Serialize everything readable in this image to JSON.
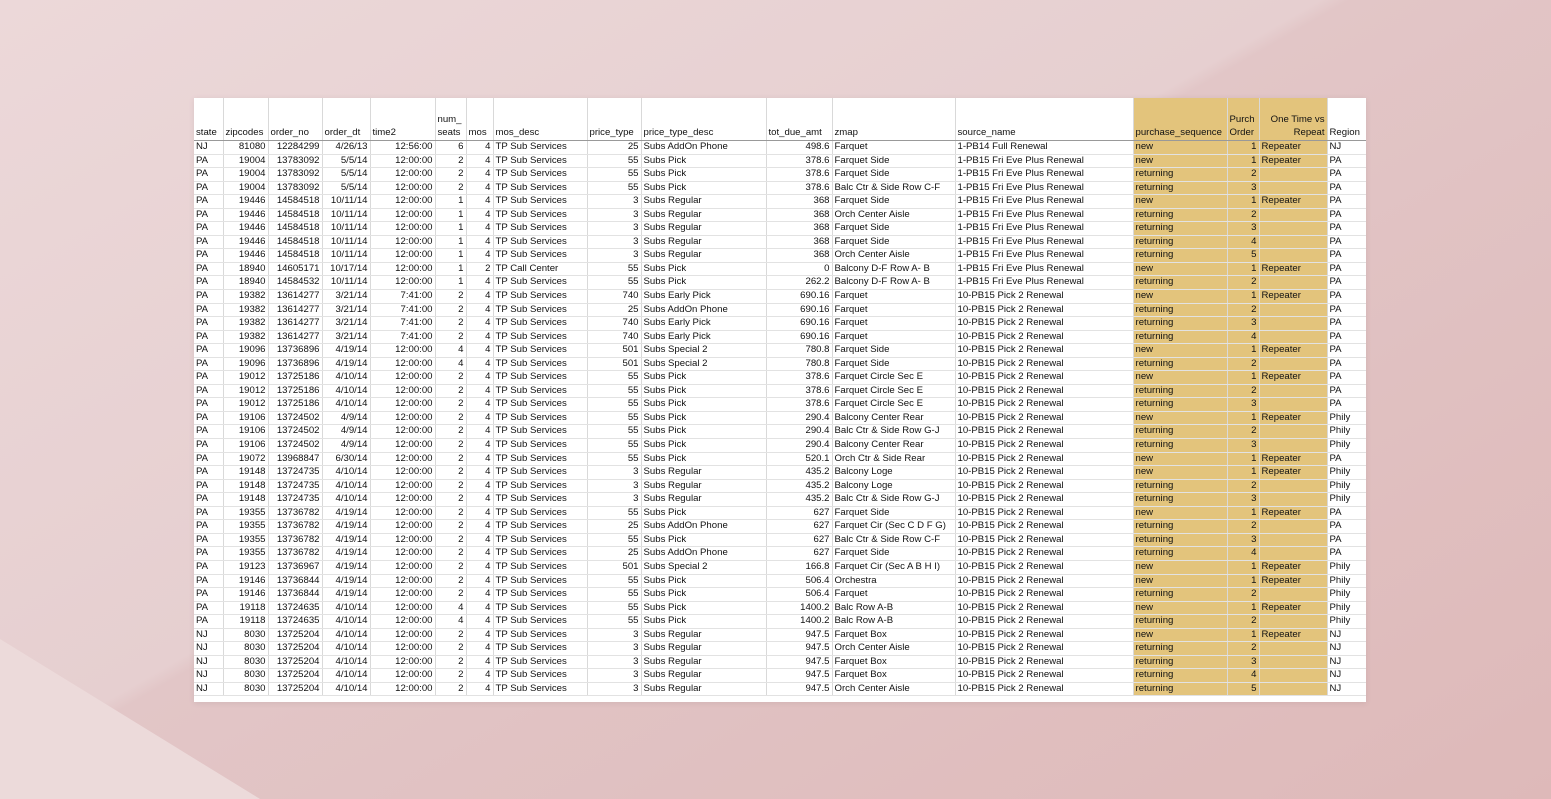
{
  "columns": [
    "state",
    "zipcodes",
    "order_no",
    "order_dt",
    "time2",
    "num_\nseats",
    "mos",
    "mos_desc",
    "price_type",
    "price_type_desc",
    "tot_due_amt",
    "zmap",
    "source_name",
    "purchase_sequence",
    "Purch\nOrder",
    "One Time vs\nRepeat",
    "Region"
  ],
  "rows": [
    [
      "NJ",
      "81080",
      "12284299",
      "4/26/13",
      "12:56:00",
      "6",
      "4",
      "TP Sub Services",
      "25",
      "Subs AddOn  Phone",
      "498.6",
      "Farquet",
      "1-PB14 Full Renewal",
      "new",
      "1",
      "Repeater",
      "NJ"
    ],
    [
      "PA",
      "19004",
      "13783092",
      "5/5/14",
      "12:00:00",
      "2",
      "4",
      "TP Sub Services",
      "55",
      "Subs Pick",
      "378.6",
      "Farquet Side",
      "1-PB15 Fri Eve Plus Renewal",
      "new",
      "1",
      "Repeater",
      "PA"
    ],
    [
      "PA",
      "19004",
      "13783092",
      "5/5/14",
      "12:00:00",
      "2",
      "4",
      "TP Sub Services",
      "55",
      "Subs Pick",
      "378.6",
      "Farquet Side",
      "1-PB15 Fri Eve Plus Renewal",
      "returning",
      "2",
      "",
      "PA"
    ],
    [
      "PA",
      "19004",
      "13783092",
      "5/5/14",
      "12:00:00",
      "2",
      "4",
      "TP Sub Services",
      "55",
      "Subs Pick",
      "378.6",
      "Balc Ctr & Side Row C-F",
      "1-PB15 Fri Eve Plus Renewal",
      "returning",
      "3",
      "",
      "PA"
    ],
    [
      "PA",
      "19446",
      "14584518",
      "10/11/14",
      "12:00:00",
      "1",
      "4",
      "TP Sub Services",
      "3",
      "Subs Regular",
      "368",
      "Farquet Side",
      "1-PB15 Fri Eve Plus Renewal",
      "new",
      "1",
      "Repeater",
      "PA"
    ],
    [
      "PA",
      "19446",
      "14584518",
      "10/11/14",
      "12:00:00",
      "1",
      "4",
      "TP Sub Services",
      "3",
      "Subs Regular",
      "368",
      "Orch Center Aisle",
      "1-PB15 Fri Eve Plus Renewal",
      "returning",
      "2",
      "",
      "PA"
    ],
    [
      "PA",
      "19446",
      "14584518",
      "10/11/14",
      "12:00:00",
      "1",
      "4",
      "TP Sub Services",
      "3",
      "Subs Regular",
      "368",
      "Farquet Side",
      "1-PB15 Fri Eve Plus Renewal",
      "returning",
      "3",
      "",
      "PA"
    ],
    [
      "PA",
      "19446",
      "14584518",
      "10/11/14",
      "12:00:00",
      "1",
      "4",
      "TP Sub Services",
      "3",
      "Subs Regular",
      "368",
      "Farquet Side",
      "1-PB15 Fri Eve Plus Renewal",
      "returning",
      "4",
      "",
      "PA"
    ],
    [
      "PA",
      "19446",
      "14584518",
      "10/11/14",
      "12:00:00",
      "1",
      "4",
      "TP Sub Services",
      "3",
      "Subs Regular",
      "368",
      "Orch Center Aisle",
      "1-PB15 Fri Eve Plus Renewal",
      "returning",
      "5",
      "",
      "PA"
    ],
    [
      "PA",
      "18940",
      "14605171",
      "10/17/14",
      "12:00:00",
      "1",
      "2",
      "TP Call Center",
      "55",
      "Subs Pick",
      "0",
      "Balcony D-F Row A- B",
      "1-PB15 Fri Eve Plus Renewal",
      "new",
      "1",
      "Repeater",
      "PA"
    ],
    [
      "PA",
      "18940",
      "14584532",
      "10/11/14",
      "12:00:00",
      "1",
      "4",
      "TP Sub Services",
      "55",
      "Subs Pick",
      "262.2",
      "Balcony D-F Row A- B",
      "1-PB15 Fri Eve Plus Renewal",
      "returning",
      "2",
      "",
      "PA"
    ],
    [
      "PA",
      "19382",
      "13614277",
      "3/21/14",
      "7:41:00",
      "2",
      "4",
      "TP Sub Services",
      "740",
      "Subs Early Pick",
      "690.16",
      "Farquet",
      "10-PB15 Pick 2 Renewal",
      "new",
      "1",
      "Repeater",
      "PA"
    ],
    [
      "PA",
      "19382",
      "13614277",
      "3/21/14",
      "7:41:00",
      "2",
      "4",
      "TP Sub Services",
      "25",
      "Subs AddOn  Phone",
      "690.16",
      "Farquet",
      "10-PB15 Pick 2 Renewal",
      "returning",
      "2",
      "",
      "PA"
    ],
    [
      "PA",
      "19382",
      "13614277",
      "3/21/14",
      "7:41:00",
      "2",
      "4",
      "TP Sub Services",
      "740",
      "Subs Early Pick",
      "690.16",
      "Farquet",
      "10-PB15 Pick 2 Renewal",
      "returning",
      "3",
      "",
      "PA"
    ],
    [
      "PA",
      "19382",
      "13614277",
      "3/21/14",
      "7:41:00",
      "2",
      "4",
      "TP Sub Services",
      "740",
      "Subs Early Pick",
      "690.16",
      "Farquet",
      "10-PB15 Pick 2 Renewal",
      "returning",
      "4",
      "",
      "PA"
    ],
    [
      "PA",
      "19096",
      "13736896",
      "4/19/14",
      "12:00:00",
      "4",
      "4",
      "TP Sub Services",
      "501",
      "Subs Special 2",
      "780.8",
      "Farquet Side",
      "10-PB15 Pick 2 Renewal",
      "new",
      "1",
      "Repeater",
      "PA"
    ],
    [
      "PA",
      "19096",
      "13736896",
      "4/19/14",
      "12:00:00",
      "4",
      "4",
      "TP Sub Services",
      "501",
      "Subs Special 2",
      "780.8",
      "Farquet Side",
      "10-PB15 Pick 2 Renewal",
      "returning",
      "2",
      "",
      "PA"
    ],
    [
      "PA",
      "19012",
      "13725186",
      "4/10/14",
      "12:00:00",
      "2",
      "4",
      "TP Sub Services",
      "55",
      "Subs Pick",
      "378.6",
      "Farquet Circle Sec E",
      "10-PB15 Pick 2 Renewal",
      "new",
      "1",
      "Repeater",
      "PA"
    ],
    [
      "PA",
      "19012",
      "13725186",
      "4/10/14",
      "12:00:00",
      "2",
      "4",
      "TP Sub Services",
      "55",
      "Subs Pick",
      "378.6",
      "Farquet Circle Sec E",
      "10-PB15 Pick 2 Renewal",
      "returning",
      "2",
      "",
      "PA"
    ],
    [
      "PA",
      "19012",
      "13725186",
      "4/10/14",
      "12:00:00",
      "2",
      "4",
      "TP Sub Services",
      "55",
      "Subs Pick",
      "378.6",
      "Farquet Circle Sec E",
      "10-PB15 Pick 2 Renewal",
      "returning",
      "3",
      "",
      "PA"
    ],
    [
      "PA",
      "19106",
      "13724502",
      "4/9/14",
      "12:00:00",
      "2",
      "4",
      "TP Sub Services",
      "55",
      "Subs Pick",
      "290.4",
      "Balcony Center Rear",
      "10-PB15 Pick 2 Renewal",
      "new",
      "1",
      "Repeater",
      "Phily"
    ],
    [
      "PA",
      "19106",
      "13724502",
      "4/9/14",
      "12:00:00",
      "2",
      "4",
      "TP Sub Services",
      "55",
      "Subs Pick",
      "290.4",
      "Balc Ctr & Side Row G-J",
      "10-PB15 Pick 2 Renewal",
      "returning",
      "2",
      "",
      "Phily"
    ],
    [
      "PA",
      "19106",
      "13724502",
      "4/9/14",
      "12:00:00",
      "2",
      "4",
      "TP Sub Services",
      "55",
      "Subs Pick",
      "290.4",
      "Balcony Center Rear",
      "10-PB15 Pick 2 Renewal",
      "returning",
      "3",
      "",
      "Phily"
    ],
    [
      "PA",
      "19072",
      "13968847",
      "6/30/14",
      "12:00:00",
      "2",
      "4",
      "TP Sub Services",
      "55",
      "Subs Pick",
      "520.1",
      "Orch Ctr & Side Rear",
      "10-PB15 Pick 2 Renewal",
      "new",
      "1",
      "Repeater",
      "PA"
    ],
    [
      "PA",
      "19148",
      "13724735",
      "4/10/14",
      "12:00:00",
      "2",
      "4",
      "TP Sub Services",
      "3",
      "Subs Regular",
      "435.2",
      "Balcony Loge",
      "10-PB15 Pick 2 Renewal",
      "new",
      "1",
      "Repeater",
      "Phily"
    ],
    [
      "PA",
      "19148",
      "13724735",
      "4/10/14",
      "12:00:00",
      "2",
      "4",
      "TP Sub Services",
      "3",
      "Subs Regular",
      "435.2",
      "Balcony Loge",
      "10-PB15 Pick 2 Renewal",
      "returning",
      "2",
      "",
      "Phily"
    ],
    [
      "PA",
      "19148",
      "13724735",
      "4/10/14",
      "12:00:00",
      "2",
      "4",
      "TP Sub Services",
      "3",
      "Subs Regular",
      "435.2",
      "Balc Ctr & Side Row G-J",
      "10-PB15 Pick 2 Renewal",
      "returning",
      "3",
      "",
      "Phily"
    ],
    [
      "PA",
      "19355",
      "13736782",
      "4/19/14",
      "12:00:00",
      "2",
      "4",
      "TP Sub Services",
      "55",
      "Subs Pick",
      "627",
      "Farquet Side",
      "10-PB15 Pick 2 Renewal",
      "new",
      "1",
      "Repeater",
      "PA"
    ],
    [
      "PA",
      "19355",
      "13736782",
      "4/19/14",
      "12:00:00",
      "2",
      "4",
      "TP Sub Services",
      "25",
      "Subs AddOn  Phone",
      "627",
      "Farquet Cir (Sec C  D  F  G)",
      "10-PB15 Pick 2 Renewal",
      "returning",
      "2",
      "",
      "PA"
    ],
    [
      "PA",
      "19355",
      "13736782",
      "4/19/14",
      "12:00:00",
      "2",
      "4",
      "TP Sub Services",
      "55",
      "Subs Pick",
      "627",
      "Balc Ctr & Side Row C-F",
      "10-PB15 Pick 2 Renewal",
      "returning",
      "3",
      "",
      "PA"
    ],
    [
      "PA",
      "19355",
      "13736782",
      "4/19/14",
      "12:00:00",
      "2",
      "4",
      "TP Sub Services",
      "25",
      "Subs AddOn  Phone",
      "627",
      "Farquet Side",
      "10-PB15 Pick 2 Renewal",
      "returning",
      "4",
      "",
      "PA"
    ],
    [
      "PA",
      "19123",
      "13736967",
      "4/19/14",
      "12:00:00",
      "2",
      "4",
      "TP Sub Services",
      "501",
      "Subs Special 2",
      "166.8",
      "Farquet Cir (Sec A  B  H  I)",
      "10-PB15 Pick 2 Renewal",
      "new",
      "1",
      "Repeater",
      "Phily"
    ],
    [
      "PA",
      "19146",
      "13736844",
      "4/19/14",
      "12:00:00",
      "2",
      "4",
      "TP Sub Services",
      "55",
      "Subs Pick",
      "506.4",
      "Orchestra",
      "10-PB15 Pick 2 Renewal",
      "new",
      "1",
      "Repeater",
      "Phily"
    ],
    [
      "PA",
      "19146",
      "13736844",
      "4/19/14",
      "12:00:00",
      "2",
      "4",
      "TP Sub Services",
      "55",
      "Subs Pick",
      "506.4",
      "Farquet",
      "10-PB15 Pick 2 Renewal",
      "returning",
      "2",
      "",
      "Phily"
    ],
    [
      "PA",
      "19118",
      "13724635",
      "4/10/14",
      "12:00:00",
      "4",
      "4",
      "TP Sub Services",
      "55",
      "Subs Pick",
      "1400.2",
      "Balc Row A-B",
      "10-PB15 Pick 2 Renewal",
      "new",
      "1",
      "Repeater",
      "Phily"
    ],
    [
      "PA",
      "19118",
      "13724635",
      "4/10/14",
      "12:00:00",
      "4",
      "4",
      "TP Sub Services",
      "55",
      "Subs Pick",
      "1400.2",
      "Balc Row A-B",
      "10-PB15 Pick 2 Renewal",
      "returning",
      "2",
      "",
      "Phily"
    ],
    [
      "NJ",
      "8030",
      "13725204",
      "4/10/14",
      "12:00:00",
      "2",
      "4",
      "TP Sub Services",
      "3",
      "Subs Regular",
      "947.5",
      "Farquet Box",
      "10-PB15 Pick 2 Renewal",
      "new",
      "1",
      "Repeater",
      "NJ"
    ],
    [
      "NJ",
      "8030",
      "13725204",
      "4/10/14",
      "12:00:00",
      "2",
      "4",
      "TP Sub Services",
      "3",
      "Subs Regular",
      "947.5",
      "Orch Center Aisle",
      "10-PB15 Pick 2 Renewal",
      "returning",
      "2",
      "",
      "NJ"
    ],
    [
      "NJ",
      "8030",
      "13725204",
      "4/10/14",
      "12:00:00",
      "2",
      "4",
      "TP Sub Services",
      "3",
      "Subs Regular",
      "947.5",
      "Farquet Box",
      "10-PB15 Pick 2 Renewal",
      "returning",
      "3",
      "",
      "NJ"
    ],
    [
      "NJ",
      "8030",
      "13725204",
      "4/10/14",
      "12:00:00",
      "2",
      "4",
      "TP Sub Services",
      "3",
      "Subs Regular",
      "947.5",
      "Farquet Box",
      "10-PB15 Pick 2 Renewal",
      "returning",
      "4",
      "",
      "NJ"
    ],
    [
      "NJ",
      "8030",
      "13725204",
      "4/10/14",
      "12:00:00",
      "2",
      "4",
      "TP Sub Services",
      "3",
      "Subs Regular",
      "947.5",
      "Orch Center Aisle",
      "10-PB15 Pick 2 Renewal",
      "returning",
      "5",
      "",
      "NJ"
    ]
  ],
  "colors": {
    "highlight": "#e3c47c",
    "background": "#e9d2d3"
  }
}
